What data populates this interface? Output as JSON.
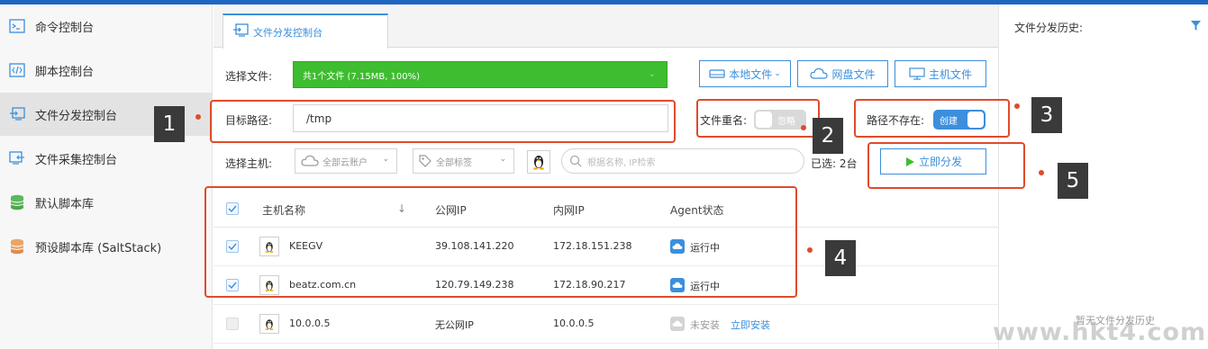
{
  "sidebar": {
    "items": [
      {
        "label": "命令控制台",
        "icon": "terminal-icon"
      },
      {
        "label": "脚本控制台",
        "icon": "code-icon"
      },
      {
        "label": "文件分发控制台",
        "icon": "file-transfer-icon",
        "active": true
      },
      {
        "label": "文件采集控制台",
        "icon": "file-collect-icon"
      },
      {
        "label": "默认脚本库",
        "icon": "database-icon"
      },
      {
        "label": "预设脚本库 (SaltStack)",
        "icon": "database-icon"
      }
    ]
  },
  "tab": {
    "label": "文件分发控制台"
  },
  "form": {
    "select_file_label": "选择文件:",
    "file_summary": "共1个文件 (7.15MB, 100%)",
    "local_file_button": "本地文件",
    "cloud_file_button": "网盘文件",
    "host_file_button": "主机文件",
    "target_path_label": "目标路径:",
    "target_path_value": "/tmp",
    "rename_label": "文件重名:",
    "rename_toggle_text": "忽略",
    "path_missing_label": "路径不存在:",
    "path_missing_toggle_text": "创建",
    "select_host_label": "选择主机:",
    "account_dropdown": "全部云账户",
    "tag_dropdown": "全部标签",
    "search_placeholder": "根据名称, IP检索",
    "selected_count": "已选: 2台",
    "dispatch_button": "立即分发"
  },
  "callouts": [
    "1",
    "2",
    "3",
    "4",
    "5"
  ],
  "table": {
    "headers": [
      "主机名称",
      "公网IP",
      "内网IP",
      "Agent状态"
    ],
    "sort_glyph": "↓",
    "rows": [
      {
        "name": "KEEGV",
        "public_ip": "39.108.141.220",
        "private_ip": "172.18.151.238",
        "status": "运行中",
        "checked": true
      },
      {
        "name": "beatz.com.cn",
        "public_ip": "120.79.149.238",
        "private_ip": "172.18.90.217",
        "status": "运行中",
        "checked": true
      },
      {
        "name": "10.0.0.5",
        "public_ip": "无公网IP",
        "private_ip": "10.0.0.5",
        "status": "未安装",
        "action": "立即安装",
        "checked": false
      }
    ]
  },
  "history": {
    "title": "文件分发历史:",
    "empty_text": "暂无文件分发历史"
  },
  "watermark": "www.hkt4.com",
  "colors": {
    "accent": "#3b8fdc",
    "file_bar": "#3dbd2f",
    "annotation": "#e04b2b",
    "top_bar": "#1f66c2"
  }
}
